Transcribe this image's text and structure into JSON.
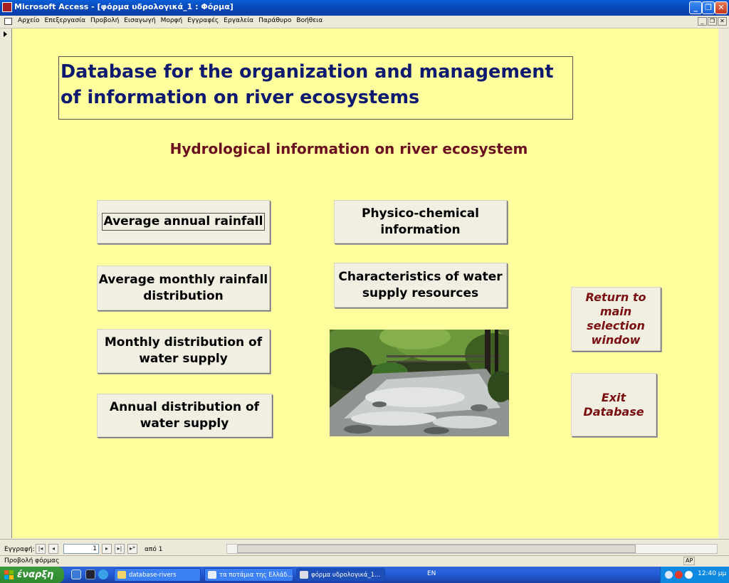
{
  "window": {
    "title": "Microsoft Access - [φόρμα υδρολογικά_1 : Φόρμα]"
  },
  "menu": {
    "items": [
      "Αρχείο",
      "Επεξεργασία",
      "Προβολή",
      "Εισαγωγή",
      "Μορφή",
      "Εγγραφές",
      "Εργαλεία",
      "Παράθυρο",
      "Βοήθεια"
    ]
  },
  "form": {
    "background": "#ffff9d",
    "db_title": "Database for the organization and management of information on river ecosystems",
    "subtitle": "Hydrological information on river ecosystem",
    "buttons": {
      "avg_annual_rainfall": "Average annual rainfall",
      "avg_monthly_rainfall": "Average monthly rainfall distribution",
      "monthly_water_supply": "Monthly distribution of water supply",
      "annual_water_supply": "Annual distribution of water supply",
      "physico_chemical": "Physico-chemical information",
      "water_supply_resources": "Characteristics of water supply resources",
      "return_main": "Return to main selection window",
      "exit_db": "Exit Database"
    },
    "image": "river-photo"
  },
  "navigation": {
    "label": "Εγγραφή:",
    "current_record": "1",
    "of_text": "από 1"
  },
  "status": {
    "text": "Προβολή φόρμας",
    "indicator": "ΑΡ"
  },
  "taskbar": {
    "start_label": "έναρξη",
    "tasks": [
      "database-rivers",
      "τα ποτάμια της Ελλάδ...",
      "φόρμα υδρολογικά_1..."
    ],
    "language": "EN",
    "clock": "12:40 μμ"
  }
}
